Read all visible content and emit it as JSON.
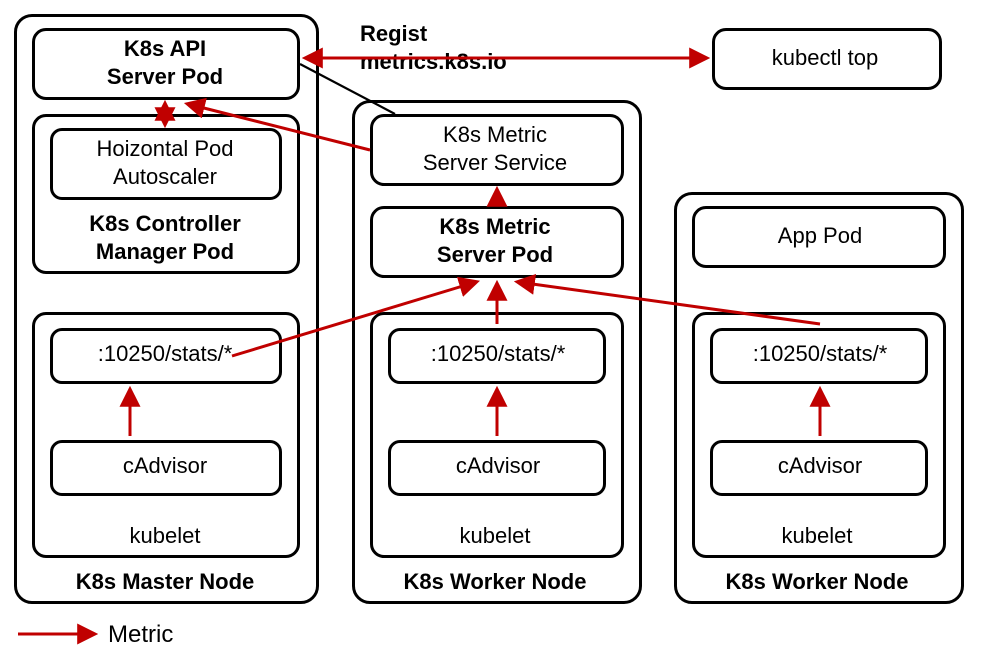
{
  "nodes": {
    "master": {
      "title": "K8s Master Node"
    },
    "worker1": {
      "title": "K8s Worker Node"
    },
    "worker2": {
      "title": "K8s Worker Node"
    }
  },
  "master": {
    "api_pod_l1": "K8s API",
    "api_pod_l2": "Server Pod",
    "controller_pod_l1": "K8s Controller",
    "controller_pod_l2": "Manager Pod",
    "hpa_l1": "Hoizontal Pod",
    "hpa_l2": "Autoscaler",
    "kubelet": {
      "title": "kubelet",
      "stats": ":10250/stats/*",
      "cadvisor": "cAdvisor"
    }
  },
  "worker1": {
    "metric_service_l1": "K8s Metric",
    "metric_service_l2": "Server Service",
    "metric_pod_l1": "K8s Metric",
    "metric_pod_l2": "Server Pod",
    "kubelet": {
      "title": "kubelet",
      "stats": ":10250/stats/*",
      "cadvisor": "cAdvisor"
    }
  },
  "worker2": {
    "app_pod": "App Pod",
    "kubelet": {
      "title": "kubelet",
      "stats": ":10250/stats/*",
      "cadvisor": "cAdvisor"
    }
  },
  "kubectl_top": "kubectl top",
  "regist_l1": "Regist",
  "regist_l2": "metrics.k8s.io",
  "legend": "Metric",
  "colors": {
    "arrow": "#C00000",
    "line": "#000000"
  }
}
